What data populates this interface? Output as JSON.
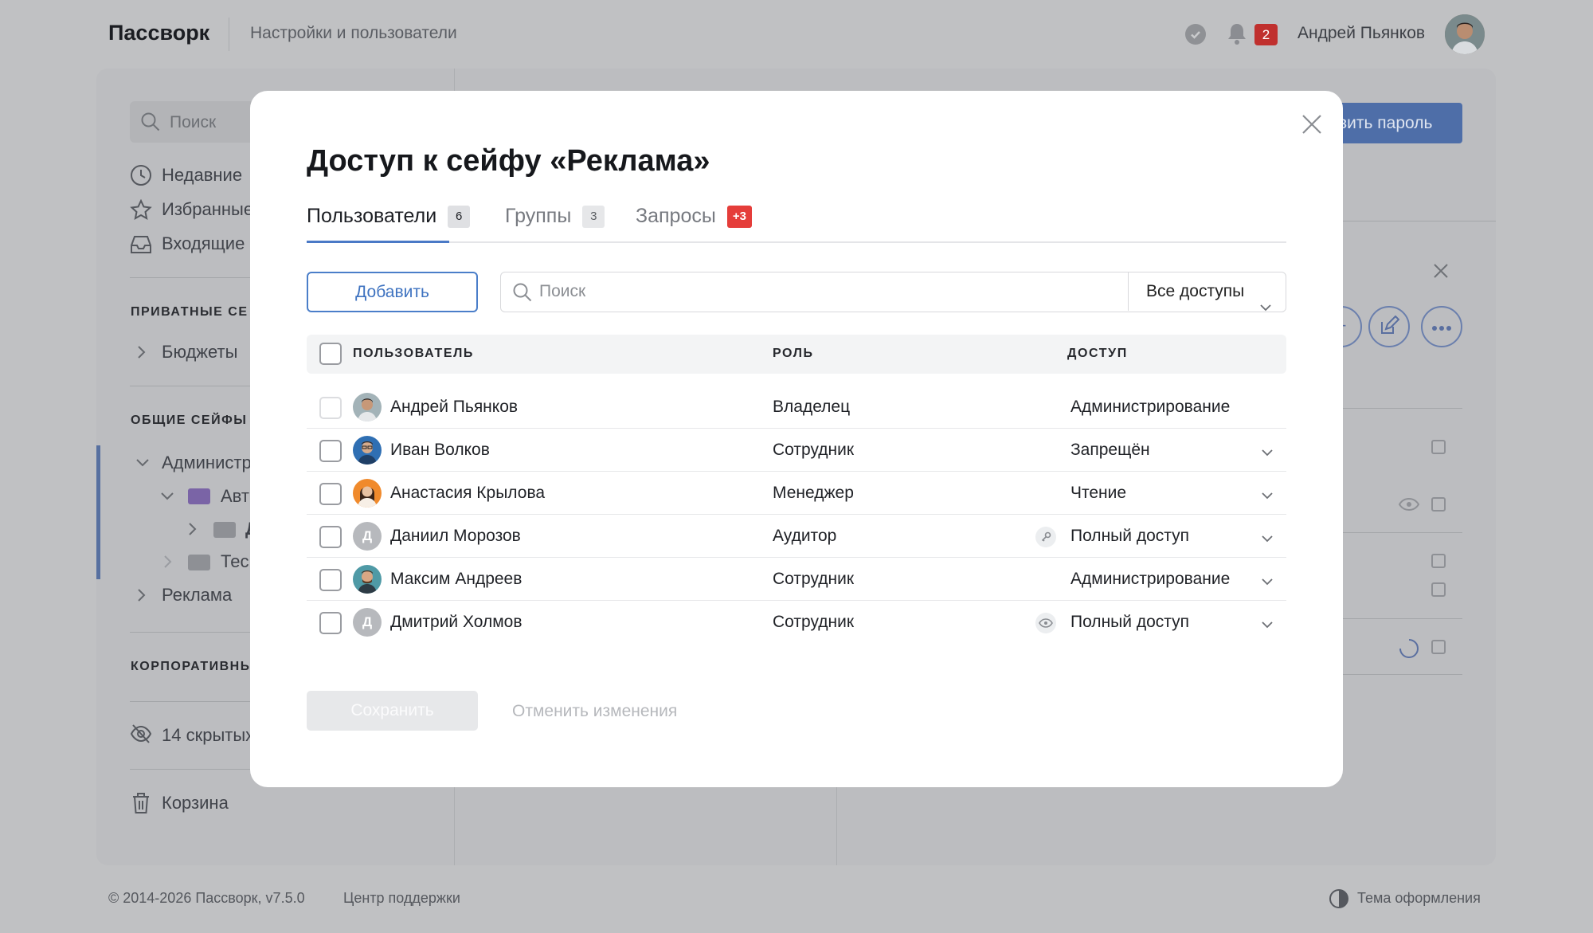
{
  "topbar": {
    "logo": "Пассворк",
    "breadcrumb": "Настройки и пользователи",
    "notification_count": "2",
    "user_name": "Андрей Пьянков"
  },
  "sidebar": {
    "search_placeholder": "Поиск",
    "nav": [
      "Недавние",
      "Избранные",
      "Входящие"
    ],
    "private_header": "ПРИВАТНЫЕ СЕ",
    "private_items": [
      "Бюджеты"
    ],
    "shared_header": "ОБЩИЕ СЕЙФЫ",
    "shared_items": [
      "Администр",
      "Авт",
      "Д",
      "Тес",
      "Реклама"
    ],
    "corporate_header": "КОРПОРАТИВНЫ",
    "hidden": "14 скрытых",
    "trash": "Корзина"
  },
  "background": {
    "add_password_button": "вить пароль"
  },
  "footer": {
    "copyright": "© 2014-2026 Пассворк, v7.5.0",
    "support": "Центр поддержки",
    "theme": "Тема оформления"
  },
  "modal": {
    "title": "Доступ к сейфу «Реклама»",
    "tabs": [
      {
        "label": "Пользователи",
        "count": "6"
      },
      {
        "label": "Группы",
        "count": "3"
      },
      {
        "label": "Запросы",
        "count": "+3"
      }
    ],
    "add_button": "Добавить",
    "search_placeholder": "Поиск",
    "filter_value": "Все доступы",
    "columns": {
      "user": "ПОЛЬЗОВАТЕЛЬ",
      "role": "РОЛЬ",
      "access": "ДОСТУП"
    },
    "rows": [
      {
        "name": "Андрей Пьянков",
        "role": "Владелец",
        "access": "Администрирование",
        "avatar": "photo",
        "avatar_letter": "",
        "access_icon": ""
      },
      {
        "name": "Иван Волков",
        "role": "Сотрудник",
        "access": "Запрещён",
        "avatar": "photo",
        "avatar_letter": "",
        "access_icon": ""
      },
      {
        "name": "Анастасия Крылова",
        "role": "Менеджер",
        "access": "Чтение",
        "avatar": "photo",
        "avatar_letter": "",
        "access_icon": ""
      },
      {
        "name": "Даниил Морозов",
        "role": "Аудитор",
        "access": "Полный доступ",
        "avatar": "letter",
        "avatar_letter": "Д",
        "access_icon": "key-icon"
      },
      {
        "name": "Максим Андреев",
        "role": "Сотрудник",
        "access": "Администрирование",
        "avatar": "photo",
        "avatar_letter": "",
        "access_icon": ""
      },
      {
        "name": "Дмитрий Холмов",
        "role": "Сотрудник",
        "access": "Полный доступ",
        "avatar": "letter",
        "avatar_letter": "Д",
        "access_icon": "eye-icon"
      }
    ],
    "save_button": "Сохранить",
    "cancel_button": "Отменить изменения"
  },
  "colors": {
    "accent": "#4a7ec9",
    "badge_red": "#e53d3a",
    "overlay": "#c0c1c3"
  }
}
